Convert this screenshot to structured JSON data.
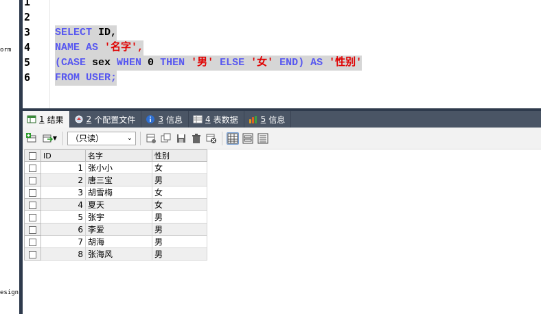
{
  "left_labels": [
    "orm",
    "esign"
  ],
  "line_numbers": [
    "1",
    "2",
    "3",
    "4",
    "5",
    "6"
  ],
  "code": {
    "line3": {
      "kw1": "SELECT",
      "rest": " ID,"
    },
    "line4": {
      "kw1": "NAME",
      "kw2": " AS ",
      "str": "'名字'",
      "rest": ","
    },
    "line5": {
      "p1": "(CASE",
      "sex": " sex ",
      "when": "WHEN",
      "zero": " 0 ",
      "then": "THEN",
      "s1": " '男' ",
      "else": "ELSE",
      "s2": " '女' ",
      "end": "END)",
      "as": " AS ",
      "s3": "'性别'"
    },
    "line6": {
      "from": "FROM",
      "user": " USER;"
    }
  },
  "tabs": [
    {
      "num": "1",
      "label": "结果"
    },
    {
      "num": "2",
      "label": "个配置文件"
    },
    {
      "num": "3",
      "label": "信息"
    },
    {
      "num": "4",
      "label": "表数据"
    },
    {
      "num": "5",
      "label": "信息"
    }
  ],
  "toolbar": {
    "readonly_select": "（只读）"
  },
  "colors": {
    "keyword": "#5858f0",
    "string": "#e00000",
    "tab_bar": "#4a5565",
    "selection": "#d6d6d6"
  },
  "grid": {
    "headers": [
      "ID",
      "名字",
      "性别"
    ],
    "rows": [
      [
        "1",
        "张小小",
        "女"
      ],
      [
        "2",
        "唐三宝",
        "男"
      ],
      [
        "3",
        "胡雪梅",
        "女"
      ],
      [
        "4",
        "夏天",
        "女"
      ],
      [
        "5",
        "张宇",
        "男"
      ],
      [
        "6",
        "李爱",
        "男"
      ],
      [
        "7",
        "胡海",
        "男"
      ],
      [
        "8",
        "张海风",
        "男"
      ]
    ]
  }
}
